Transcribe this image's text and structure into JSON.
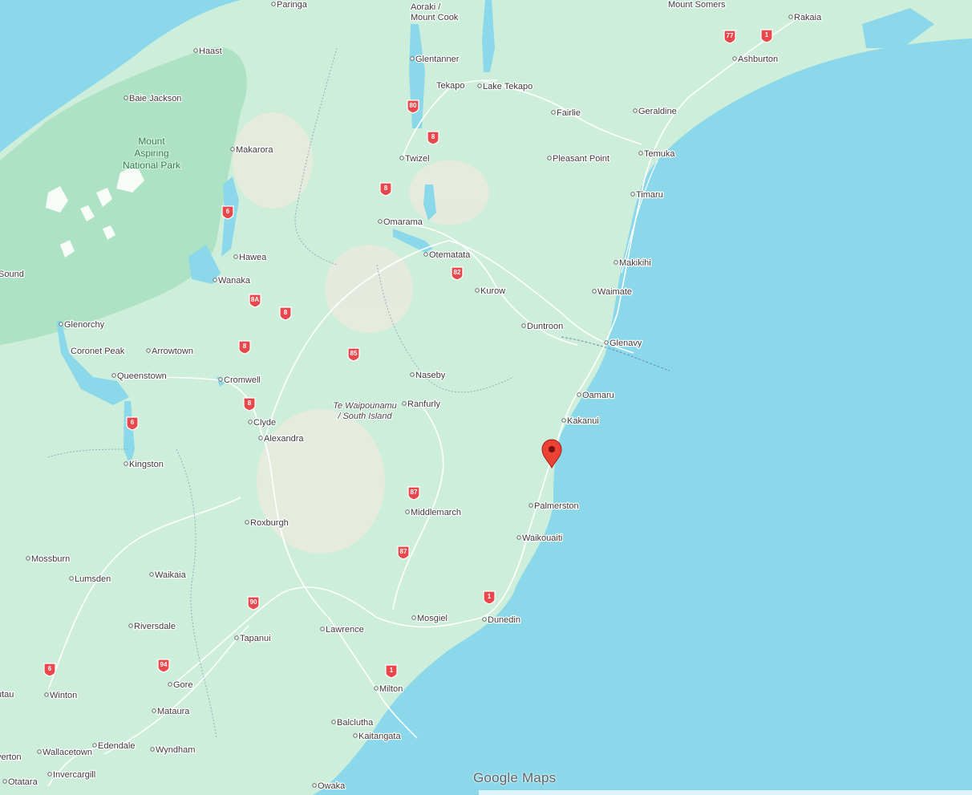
{
  "map": {
    "provider": "Google Maps",
    "region_label": [
      "Te Waipounamu",
      "/ South Island"
    ],
    "park_label": [
      "Mount",
      "Aspiring",
      "National Park"
    ],
    "colors": {
      "water": "#8bd8ea",
      "land": "#cdeedb",
      "park": "#a8dfc0",
      "road": "#ffffff",
      "shield": "#e8474b",
      "marker": "#ea4335"
    },
    "places": [
      "Paringa",
      "Aoraki /",
      "Mount Cook",
      "Mount Somers",
      "Rakaia",
      "Haast",
      "Glentanner",
      "Ashburton",
      "Baie Jackson",
      "Tekapo",
      "Lake Tekapo",
      "Fairlie",
      "Geraldine",
      "Makarora",
      "Twizel",
      "Temuka",
      "Pleasant Point",
      "Timaru",
      "Omarama",
      "Hawea",
      "Otematata",
      "Makikihi",
      "Sound",
      "Wanaka",
      "Kurow",
      "Waimate",
      "Glenorchy",
      "Duntroon",
      "Glenavy",
      "Coronet Peak",
      "Arrowtown",
      "Queenstown",
      "Cromwell",
      "Naseby",
      "Oamaru",
      "Ranfurly",
      "Clyde",
      "Kakanui",
      "Alexandra",
      "Kingston",
      "Palmerston",
      "Middlemarch",
      "Roxburgh",
      "Waikouaiti",
      "Mossburn",
      "Lumsden",
      "Waikaia",
      "Riversdale",
      "Lawrence",
      "Mosgiel",
      "Dunedin",
      "Tapanui",
      "Gore",
      "Winton",
      "Milton",
      "Mataura",
      "Balclutha",
      "Kaitangata",
      "Edendale",
      "Wallacetown",
      "Wyndham",
      "Invercargill",
      "Otatara",
      "Owaka",
      "utau",
      "verton"
    ],
    "shields": [
      "80",
      "8",
      "8",
      "6",
      "8",
      "8A",
      "8",
      "8",
      "82",
      "85",
      "8",
      "6",
      "87",
      "87",
      "1",
      "90",
      "94",
      "6",
      "1",
      "77",
      "1"
    ]
  }
}
